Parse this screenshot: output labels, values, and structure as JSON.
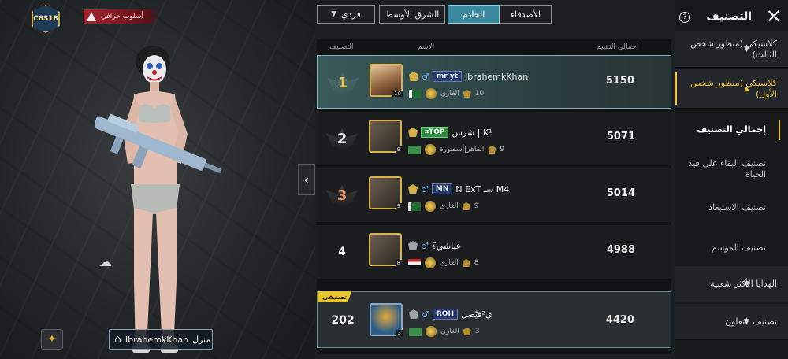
{
  "player": {
    "season_badge": "C6S18",
    "style_tag": "أسلوب حرافي",
    "name": "IbrahemkKhan",
    "home_label": "منزل"
  },
  "controls": {
    "mode": "فردي",
    "region": "الشرق الأوسط",
    "server": "الخادم",
    "friends": "الأصدقاء"
  },
  "list_header": {
    "rank": "التصنيف",
    "name": "الاسم",
    "score": "إجمالي التقييم"
  },
  "rows": [
    {
      "rank": "1",
      "name": "IbrahemkKhan",
      "clan": "mr yt",
      "tier": "الغازي",
      "level": "10",
      "score": "5150"
    },
    {
      "rank": "2",
      "name": "شرس | K¹",
      "clan": "⌗TOP",
      "tier": "القاهر|أسطورة",
      "level": "9",
      "score": "5071"
    },
    {
      "rank": "3",
      "name": "N ExT سـ M4",
      "clan": "MN",
      "tier": "الغازي",
      "level": "9",
      "score": "5014"
    },
    {
      "rank": "4",
      "name": "عياشي؟",
      "clan": "",
      "tier": "الغازي",
      "level": "8",
      "score": "4988"
    }
  ],
  "my_row": {
    "tag": "تصنيفي",
    "rank": "202",
    "name": "ي²فيّصل",
    "clan": "ROH",
    "tier": "الغازي",
    "level": "3",
    "score": "4420"
  },
  "sidebar": {
    "title": "التصنيف",
    "categories": [
      "كلاسيكي (منظور شخص الثالث)",
      "كلاسيكي (منظور شخص الأول)"
    ],
    "subitems": [
      "إجمالي التصنيف",
      "تصنيف البقاء على قيد الحياة",
      "تصنيف الاستبعاد",
      "تصنيف الموسم"
    ],
    "more": [
      "الهدايا الأكثر شعبية",
      "تصنيف التعاون"
    ]
  }
}
